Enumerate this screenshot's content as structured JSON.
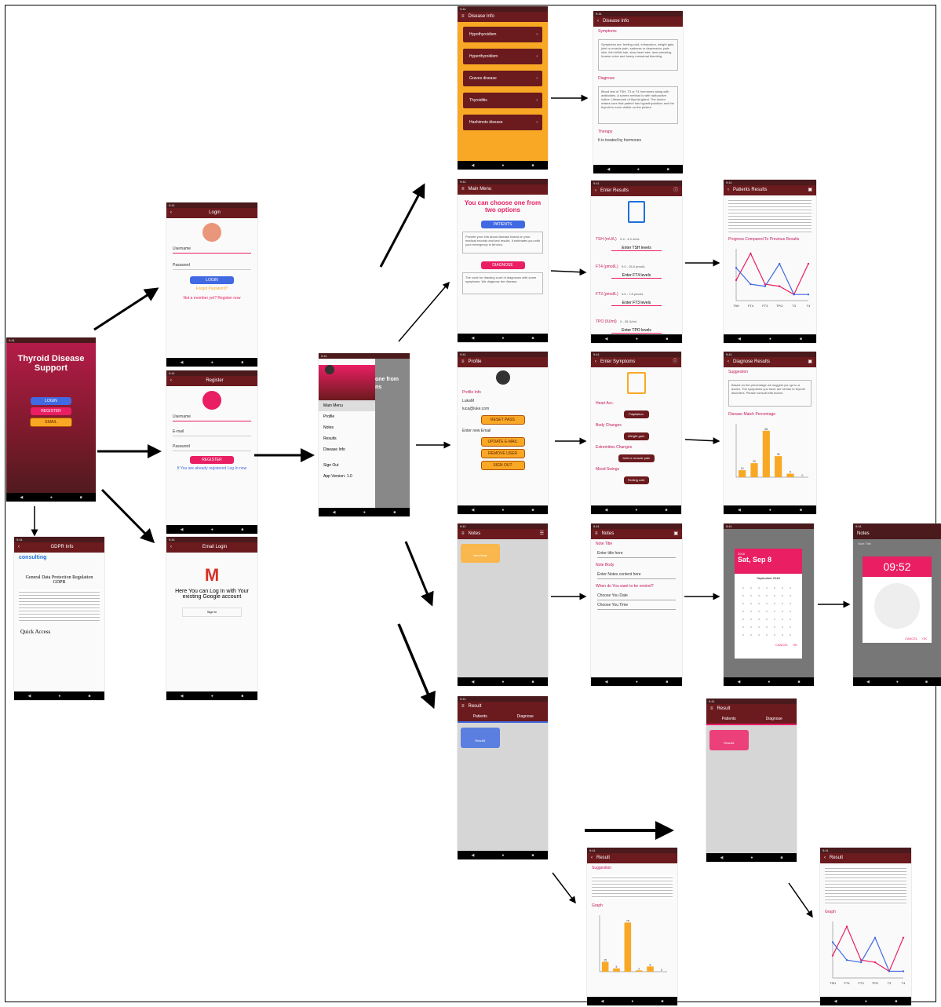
{
  "colors": {
    "primary": "#6b1a1e",
    "accent": "#e91e63",
    "blue": "#4169e1",
    "orange": "#f9a825"
  },
  "splash": {
    "title_line1": "Thyroid Disease",
    "title_line2": "Support",
    "login": "LOGIN",
    "register": "REGISTER",
    "email": "EMAIL"
  },
  "login": {
    "title": "Login",
    "username": "Username",
    "password": "Password",
    "login_btn": "LOGIN",
    "forgot": "Forgot Password?",
    "not_member": "Not a member yet? Register now"
  },
  "register": {
    "title": "Register",
    "username": "Username",
    "email": "E-mail",
    "password": "Password",
    "register_btn": "REGISTER",
    "already": "If You are already registered Log In now"
  },
  "email_login": {
    "title": "Email Login",
    "message": "Here You can Log In with Your existing Google account",
    "google_btn": "Sign in"
  },
  "gdpr": {
    "title": "GDPR Info",
    "logo": "consulting",
    "heading": "General Data Protection Regulation GDPR",
    "quick": "Quick Access"
  },
  "drawer": {
    "items": [
      "Main Menu",
      "Profile",
      "Notes",
      "Results",
      "Disease Info"
    ],
    "sign_out": "Sign Out",
    "version": "App Version: 1.0",
    "header_bg": "one from",
    "header_bg2": "ns"
  },
  "disease_info": {
    "title": "Disease Info",
    "items": [
      "Hypothyroidism",
      "Hyperthyroidism",
      "Graves disease",
      "Thyroiditis",
      "Hashimoto disease"
    ]
  },
  "disease_detail": {
    "title": "Disease Info",
    "symptoms": "Symptoms",
    "symptoms_text": "Symptoms are: feeling cold, exhaustion, weight gain, joint or muscle pain, sadness or depression, pale skin, thin brittle hair, slow heart rate, less sweating, hoarse voice and heavy menstrual bleeding.",
    "diagnose": "Diagnose",
    "diagnose_text": "Blood test of TSH, T3 or T4 hormones along with antibodies. A screen method is with radioactive iodine. Ultrasound of thyroid gland. The doctor makes sure that patient has hyperthyroidism and the thyroid is more visible on the picture.",
    "therapy": "Therapy",
    "therapy_text": "It is treated by hormones"
  },
  "main_menu": {
    "title": "Main Menu",
    "heading": "You can choose one from two options",
    "patients": "PATIENTS",
    "patients_text": "Provide your info about disease based on your medical records and test results. It estimates you with your emergency in tehnics.",
    "diagnose": "DIAGNOSE",
    "diagnose_text": "The code for drawing a set of diagnoses with some symptoms. We diagnose the disease."
  },
  "enter_results": {
    "title": "Enter Results",
    "rows": [
      {
        "label": "TSH (mU/L)",
        "range": "0.4 - 4.0 mU/L",
        "btn": "Enter TSH levels"
      },
      {
        "label": "FT4 (pmol/L)",
        "range": "9.0 - 25.0 pmol/L",
        "btn": "Enter FT4 levels"
      },
      {
        "label": "FT3 (pmol/L)",
        "range": "3.5 - 7.8 pmol/L",
        "btn": "Enter FT3 levels"
      },
      {
        "label": "TPO (IU/ml)",
        "range": "0 - 35 IU/ml",
        "btn": "Enter TPO levels"
      }
    ]
  },
  "patients_results": {
    "title": "Patients Results",
    "progress": "Progress Compared To Previous Results"
  },
  "profile": {
    "title": "Profile",
    "info": "Profile Info",
    "name": "LukaM",
    "email": "luca@luke.com",
    "reset": "RESET PASS",
    "enter_email": "Enter new Email",
    "update": "UPDATE E-MAIL",
    "remove": "REMOVE USER",
    "sign_out": "SIGN OUT"
  },
  "enter_symptoms": {
    "title": "Enter Symptoms",
    "sections": [
      {
        "label": "Heart Acc.",
        "chip": "Palpitation"
      },
      {
        "label": "Body Changes",
        "chip": "Weight gain"
      },
      {
        "label": "Extremities Changes",
        "chip": "Joint or muscle pain"
      },
      {
        "label": "Mood Swings",
        "chip": "Feeling cold"
      }
    ]
  },
  "diagnose_results": {
    "title": "Diagnose Results",
    "suggestion": "Suggestion",
    "suggestion_text": "Based on the percentage we suggest you go to a doctor. The symptoms you have are similar to thyroid disorders. Please consult with doctor.",
    "match": "Disease Match Percentage"
  },
  "notes": {
    "title": "Notes",
    "tile": "New Note"
  },
  "note_edit": {
    "title": "Notes",
    "note_title": "Note Title",
    "enter_title": "Enter title here",
    "note_body": "Note Body",
    "enter_body": "Enter Notes content here",
    "when": "When do You want to be remind?",
    "date": "Choose You Date",
    "time": "Choose You Time"
  },
  "date_picker": {
    "year": "2018",
    "date": "Sat, Sep 8",
    "month": "September 2018",
    "cancel": "CANCEL",
    "ok": "OK"
  },
  "time_picker": {
    "time": "09:52",
    "cancel": "CANCEL",
    "ok": "OK",
    "title": "Notes",
    "note_title": "Note Title"
  },
  "result_list": {
    "title": "Result",
    "tab1": "Patients",
    "tab2": "Diagnose",
    "tile": "Result1"
  },
  "result_list2": {
    "title": "Result",
    "tab1": "Patients",
    "tab2": "Diagnose",
    "tile": "Result1"
  },
  "result_diag": {
    "title": "Result",
    "suggestion": "Suggestion",
    "graph": "Graph"
  },
  "result_patient": {
    "title": "Result",
    "graph": "Graph"
  },
  "chart_data": [
    {
      "type": "line",
      "title": "",
      "categories": [
        "TSH",
        "FT4",
        "FT3",
        "TPO",
        "T3",
        "T4"
      ],
      "series": [
        {
          "name": "",
          "values": [
            10,
            23,
            8,
            7,
            3,
            18
          ]
        },
        {
          "name": "",
          "values": [
            16,
            8,
            7,
            18,
            3,
            3
          ]
        }
      ]
    },
    {
      "type": "bar",
      "title": "Disease Match Percentage",
      "categories": [
        "Hypothyroidism",
        "Hyperthyroidism",
        "Graves disease",
        "Thyroiditis",
        "Hashimoto",
        "Other"
      ],
      "values": [
        10,
        20,
        66,
        30,
        5,
        0
      ]
    },
    {
      "type": "bar",
      "title": "Graph",
      "categories": [
        "Hypothyroidism",
        "Hyperthyroidism",
        "Graves disease",
        "Thyroiditis",
        "Hashimoto",
        "Other"
      ],
      "values": [
        15,
        5,
        75,
        2,
        8,
        0
      ]
    }
  ]
}
